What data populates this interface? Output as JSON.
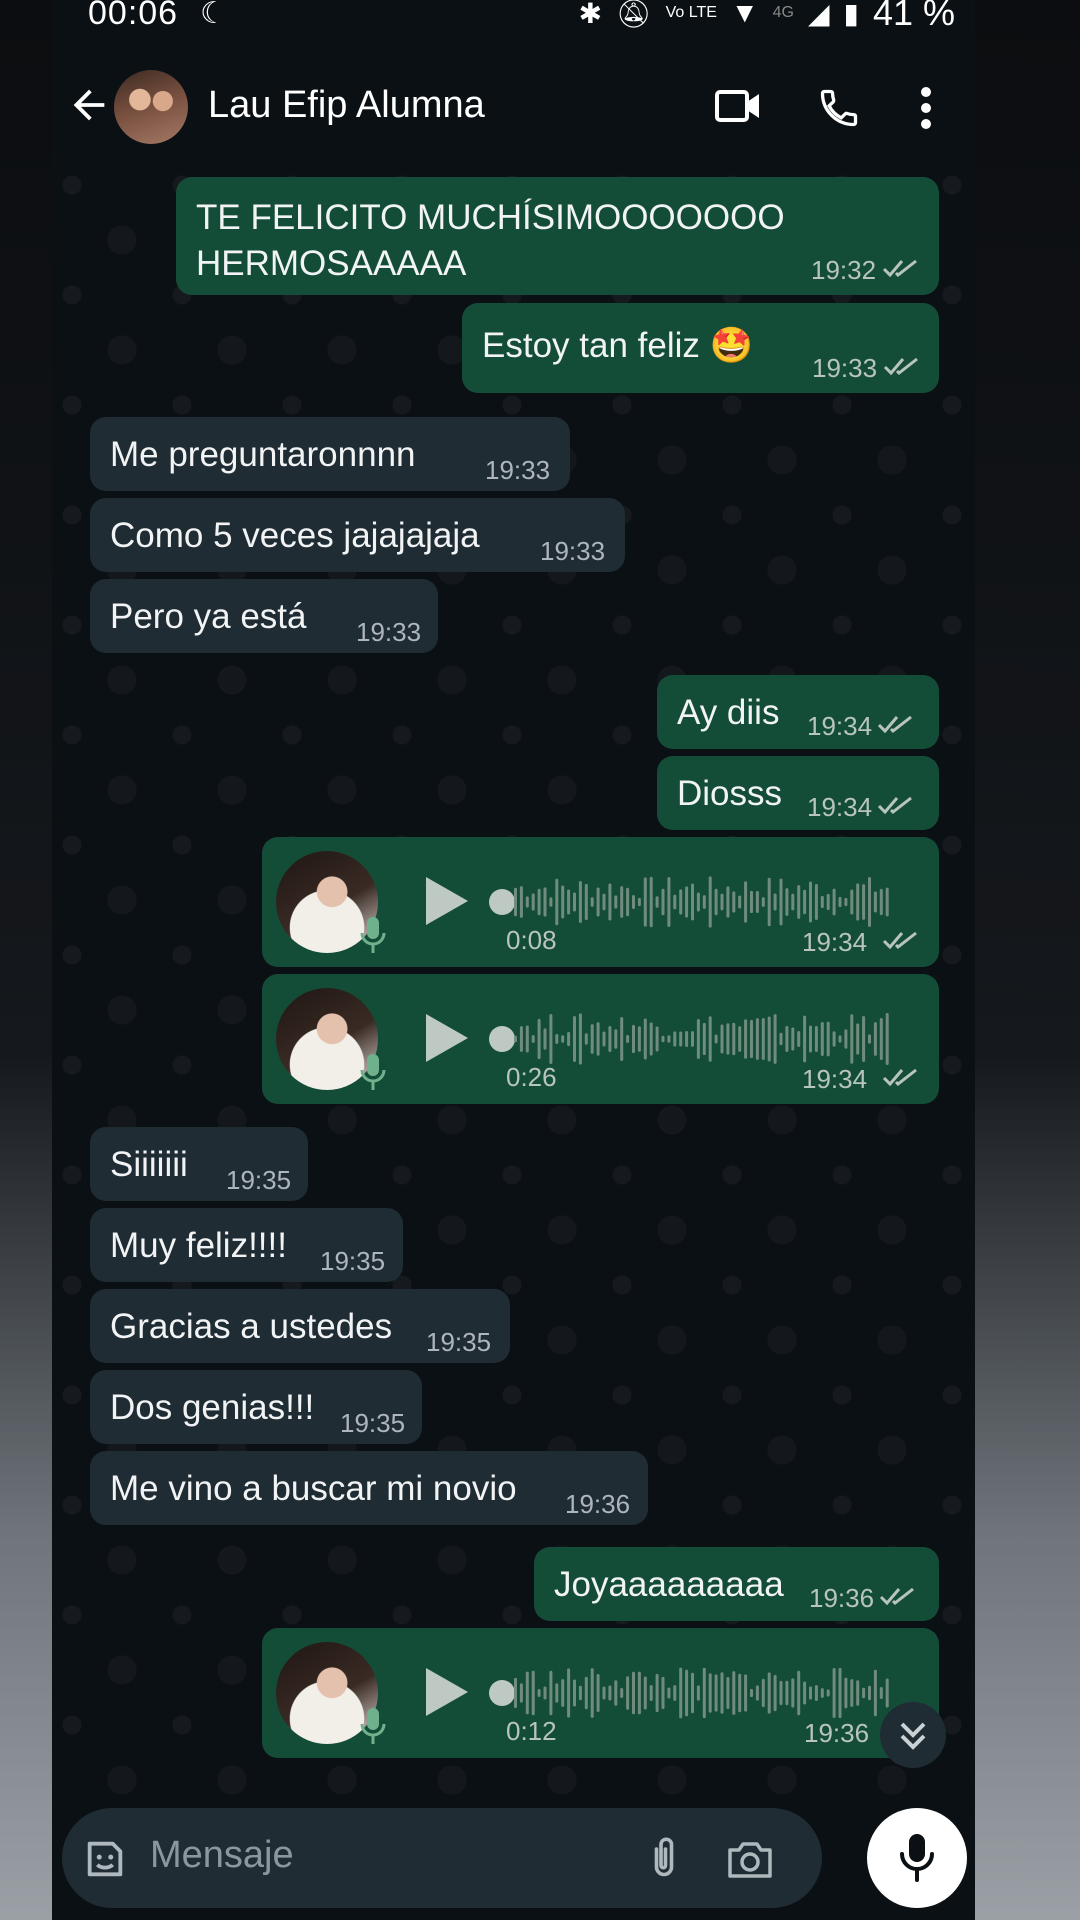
{
  "status_bar": {
    "time": "00:06",
    "battery": "41 %",
    "network": "4G",
    "volte": "Vo LTE"
  },
  "header": {
    "contact_name": "Lau Efip Alumna",
    "icons": [
      "back-arrow-icon",
      "video-call-icon",
      "voice-call-icon",
      "more-options-icon"
    ]
  },
  "messages": [
    {
      "dir": "out",
      "text_line1": "TE FELICITO MUCHÍSIMOOOOOOO",
      "text_line2": "HERMOSAAAAA",
      "time": "19:32"
    },
    {
      "dir": "out",
      "text": "Estoy tan feliz 🤩",
      "time": "19:33"
    },
    {
      "dir": "in",
      "text": "Me preguntaronnnn",
      "time": "19:33"
    },
    {
      "dir": "in",
      "text": "Como 5 veces jajajajaja",
      "time": "19:33"
    },
    {
      "dir": "in",
      "text": "Pero ya está",
      "time": "19:33"
    },
    {
      "dir": "out",
      "text": "Ay diis",
      "time": "19:34"
    },
    {
      "dir": "out",
      "text": "Diosss",
      "time": "19:34"
    },
    {
      "dir": "out",
      "type": "voice",
      "duration": "0:08",
      "time": "19:34"
    },
    {
      "dir": "out",
      "type": "voice",
      "duration": "0:26",
      "time": "19:34"
    },
    {
      "dir": "in",
      "text": "Siiiiiii",
      "time": "19:35"
    },
    {
      "dir": "in",
      "text": "Muy feliz!!!!",
      "time": "19:35"
    },
    {
      "dir": "in",
      "text": "Gracias a ustedes",
      "time": "19:35"
    },
    {
      "dir": "in",
      "text": "Dos genias!!!",
      "time": "19:35"
    },
    {
      "dir": "in",
      "text": "Me vino a buscar mi novio",
      "time": "19:36"
    },
    {
      "dir": "out",
      "text": "Joyaaaaaaaaa",
      "time": "19:36"
    },
    {
      "dir": "out",
      "type": "voice",
      "duration": "0:12",
      "time": "19:36"
    }
  ],
  "input": {
    "placeholder": "Mensaje"
  },
  "colors": {
    "outgoing_bubble": "#144d37",
    "incoming_bubble": "#1f2c33",
    "background": "#0b1014",
    "read_ticks": "#b8c4be"
  }
}
